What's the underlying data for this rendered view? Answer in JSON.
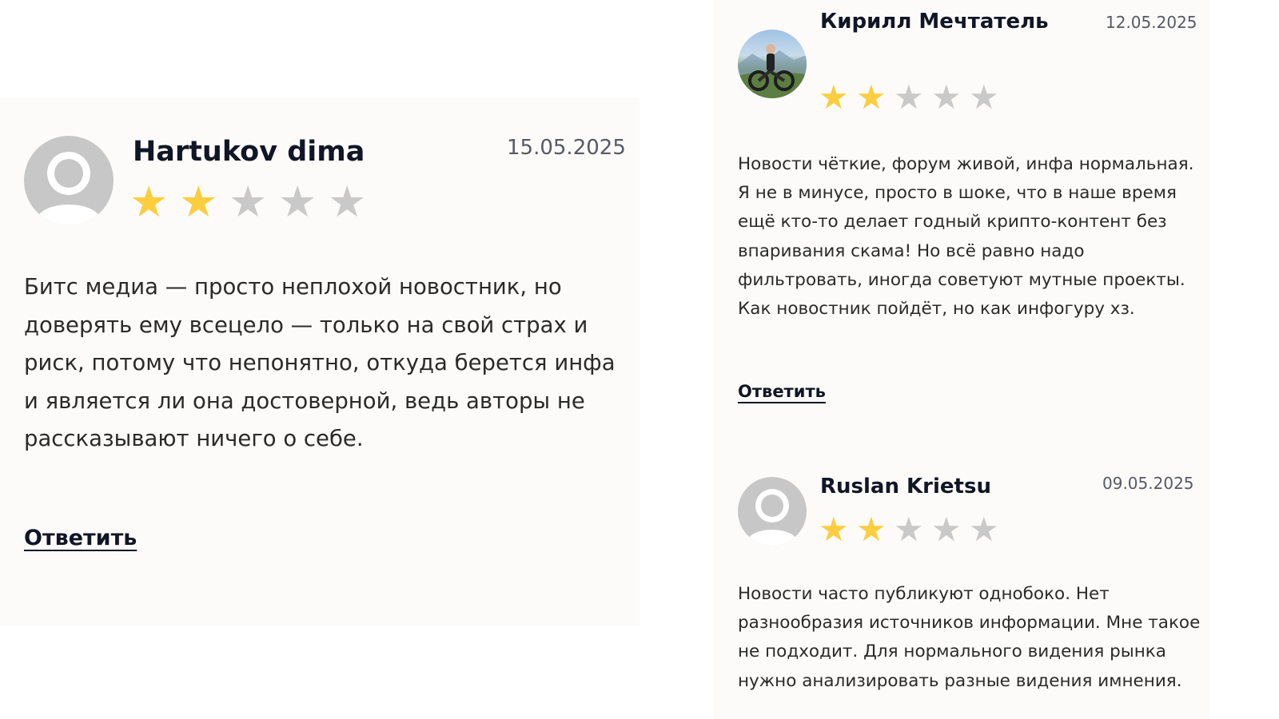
{
  "reviews": [
    {
      "author": "Hartukov dima",
      "date": "15.05.2025",
      "rating": 2,
      "max_rating": 5,
      "avatar": "default-user-icon",
      "text": "Битс медиа — просто неплохой новостник, но доверять ему всецело — только на свой страх и риск, потому что непонятно, откуда берется инфа и является ли она достоверной, ведь авторы не рассказывают ничего о себе.",
      "reply_label": "Ответить"
    },
    {
      "author": "Кирилл Мечтатель",
      "date": "12.05.2025",
      "rating": 2,
      "max_rating": 5,
      "avatar": "user-photo",
      "text": "Новости чёткие, форум живой, инфа нормальная. Я не в минусе, просто в шоке, что в наше время ещё кто-то делает годный крипто-контент без впаривания скама! Но всё равно надо фильтровать, иногда советуют мутные проекты. Как новостник пойдёт, но как инфогуру хз.",
      "reply_label": "Ответить"
    },
    {
      "author": "Ruslan Krietsu",
      "date": "09.05.2025",
      "rating": 2,
      "max_rating": 5,
      "avatar": "default-user-icon",
      "text": "Новости часто публикуют однобоко. Нет разнообразия источников информации. Мне такое не подходит. Для нормального видения рынка нужно анализировать разные видения имнения."
    }
  ],
  "colors": {
    "card_background": "#fdfbf9",
    "star_active": "#fbce3f",
    "star_inactive": "#c9c9c9",
    "avatar_placeholder": "#c7c7c7",
    "name_text": "#101626"
  },
  "icons": {
    "star": "★"
  }
}
